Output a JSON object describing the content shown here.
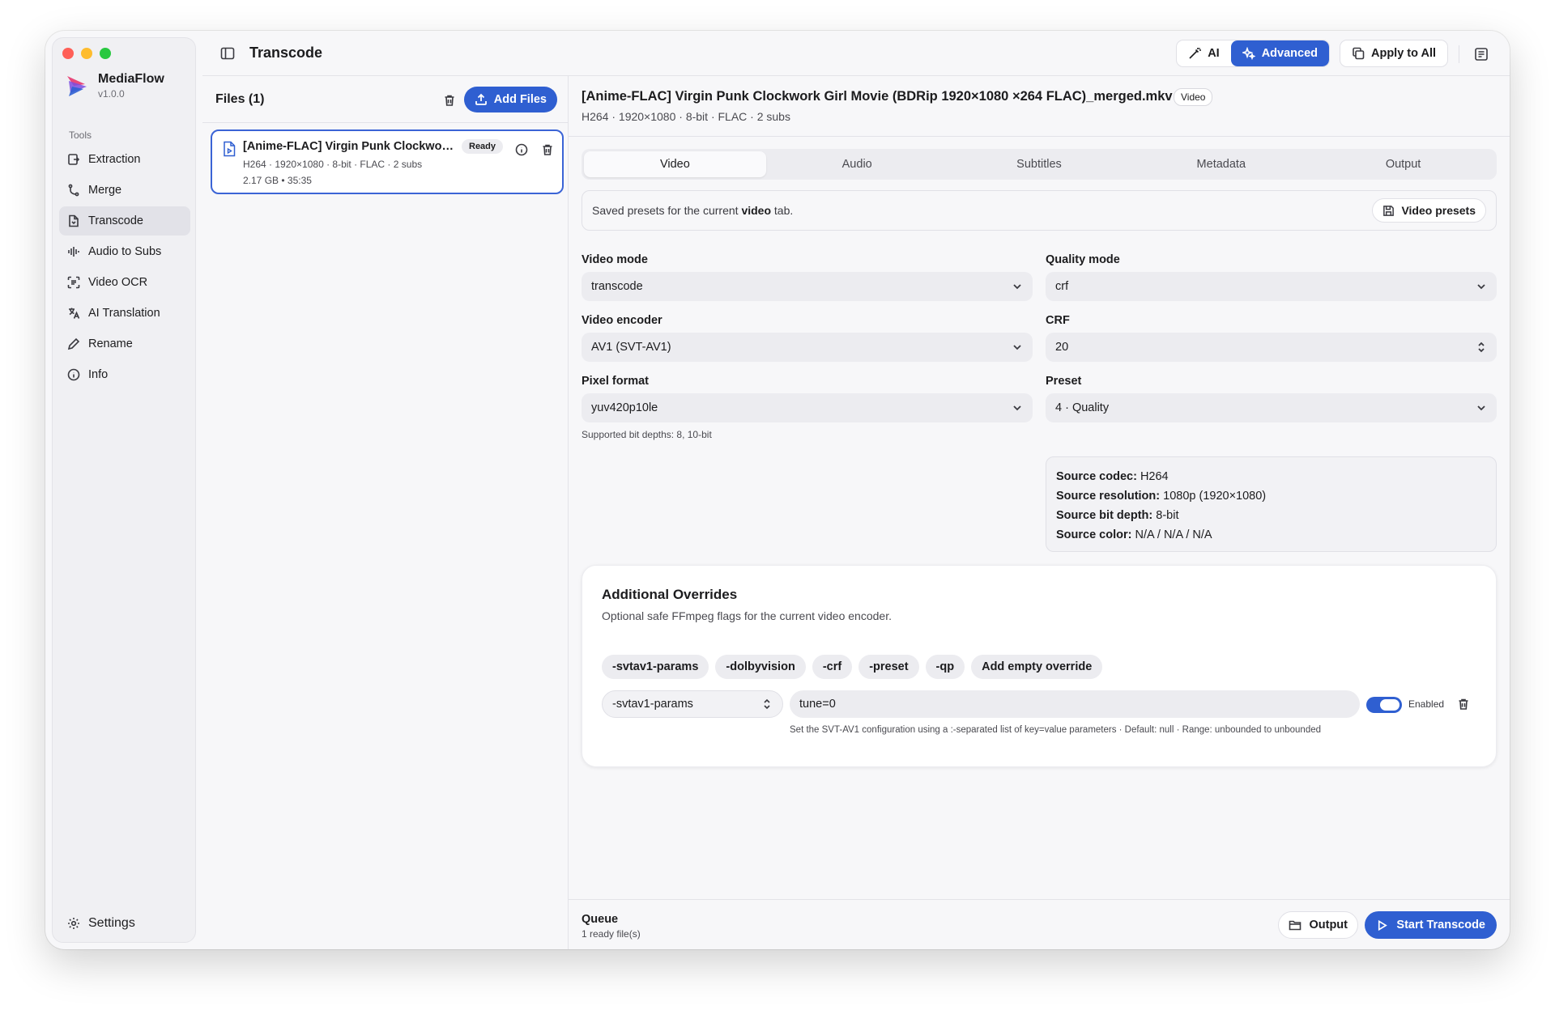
{
  "app": {
    "name": "MediaFlow",
    "version": "v1.0.0"
  },
  "sidebar": {
    "section_label": "Tools",
    "items": [
      {
        "label": "Extraction",
        "icon": "extract-icon"
      },
      {
        "label": "Merge",
        "icon": "merge-icon"
      },
      {
        "label": "Transcode",
        "icon": "file-icon",
        "active": true
      },
      {
        "label": "Audio to Subs",
        "icon": "waveform-icon"
      },
      {
        "label": "Video OCR",
        "icon": "scan-icon"
      },
      {
        "label": "AI Translation",
        "icon": "translate-icon"
      },
      {
        "label": "Rename",
        "icon": "pencil-icon"
      },
      {
        "label": "Info",
        "icon": "info-icon"
      }
    ],
    "settings_label": "Settings"
  },
  "topbar": {
    "title": "Transcode",
    "ai_label": "AI",
    "advanced_label": "Advanced",
    "apply_all_label": "Apply to All"
  },
  "files": {
    "title": "Files (1)",
    "add_label": "Add Files",
    "items": [
      {
        "name": "[Anime-FLAC] Virgin Punk Clockwork Girl Movie (BDRip 1920×1080 ×264 FLAC)_merged.mkv",
        "status": "Ready",
        "meta": "H264 · 1920×1080 · 8-bit · FLAC · 2 subs",
        "size_duration": "2.17 GB   • 35:35"
      }
    ]
  },
  "main": {
    "filename": "[Anime-FLAC] Virgin Punk Clockwork Girl Movie (BDRip 1920×1080 ×264 FLAC)_merged.mkv",
    "badge": "Video",
    "subtitle": "H264 · 1920×1080 · 8-bit · FLAC · 2 subs",
    "tabs": [
      "Video",
      "Audio",
      "Subtitles",
      "Metadata",
      "Output"
    ],
    "active_tab": "Video",
    "presets": {
      "text_before": "Saved presets for the current ",
      "text_bold": "video",
      "text_after": " tab.",
      "button": "Video presets"
    },
    "fields": {
      "video_mode": {
        "label": "Video mode",
        "value": "transcode"
      },
      "quality_mode": {
        "label": "Quality mode",
        "value": "crf"
      },
      "video_encoder": {
        "label": "Video encoder",
        "value": "AV1 (SVT-AV1)"
      },
      "crf": {
        "label": "CRF",
        "value": "20"
      },
      "pixel_format": {
        "label": "Pixel format",
        "value": "yuv420p10le",
        "hint": "Supported bit depths: 8, 10-bit"
      },
      "preset": {
        "label": "Preset",
        "value": "4 · Quality"
      }
    },
    "source": {
      "codec_label": "Source codec:",
      "codec": "H264",
      "resolution_label": "Source resolution:",
      "resolution": "1080p (1920×1080)",
      "bitdepth_label": "Source bit depth:",
      "bitdepth": "8-bit",
      "color_label": "Source color:",
      "color": "N/A / N/A / N/A"
    },
    "overrides": {
      "title": "Additional Overrides",
      "subtitle": "Optional safe FFmpeg flags for the current video encoder.",
      "chips": [
        "-svtav1-params",
        "-dolbyvision",
        "-crf",
        "-preset",
        "-qp",
        "Add empty override"
      ],
      "row": {
        "flag": "-svtav1-params",
        "value": "tune=0",
        "enabled": true,
        "enabled_label": "Enabled",
        "help": "Set the SVT-AV1 configuration using a :-separated list of key=value parameters · Default: null · Range: unbounded to unbounded"
      }
    }
  },
  "footer": {
    "queue_title": "Queue",
    "queue_sub": "1 ready file(s)",
    "output_label": "Output",
    "start_label": "Start Transcode"
  },
  "colors": {
    "accent": "#2f5fd1",
    "background": "#f7f7f9",
    "sidebar": "#f0f0f3"
  }
}
